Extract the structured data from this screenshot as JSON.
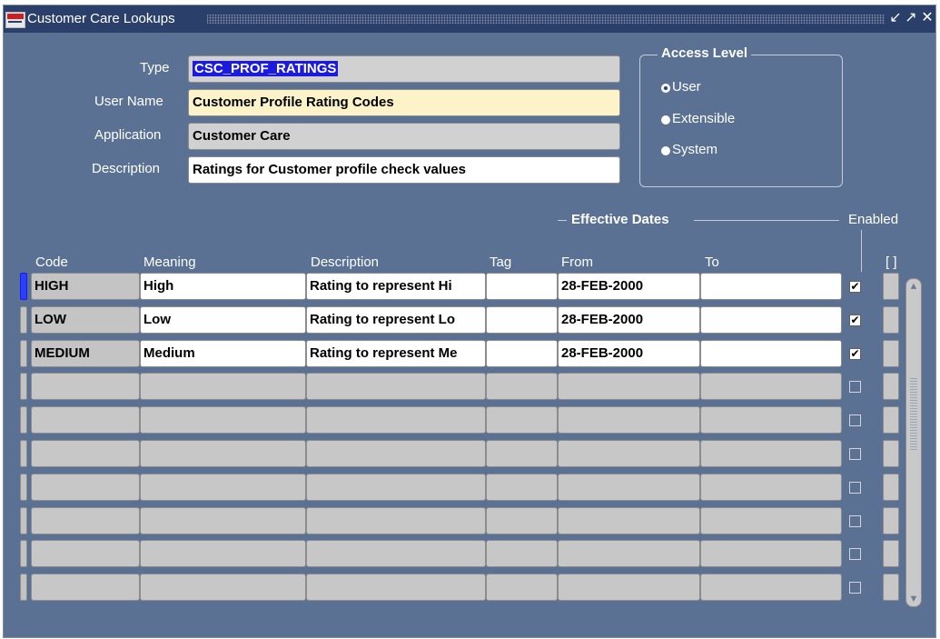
{
  "window": {
    "title": "Customer Care Lookups",
    "controls": [
      "minimize-icon",
      "maximize-icon",
      "close-icon"
    ]
  },
  "header_form": {
    "type_label": "Type",
    "type_value": "CSC_PROF_RATINGS",
    "user_name_label": "User Name",
    "user_name_value": "Customer Profile Rating Codes",
    "application_label": "Application",
    "application_value": "Customer Care",
    "description_label": "Description",
    "description_value": "Ratings for Customer profile check values"
  },
  "access_level": {
    "title": "Access Level",
    "selected": "User",
    "options": [
      "User",
      "Extensible",
      "System"
    ]
  },
  "grid": {
    "effective_dates_label": "Effective Dates",
    "enabled_label": "Enabled",
    "columns": {
      "code": "Code",
      "meaning": "Meaning",
      "description": "Description",
      "tag": "Tag",
      "from": "From",
      "to": "To",
      "flex": "[ ]"
    },
    "rows": [
      {
        "code": "HIGH",
        "meaning": "High",
        "description": "Rating to represent Hi",
        "tag": "",
        "from": "28-FEB-2000",
        "to": "",
        "enabled": true
      },
      {
        "code": "LOW",
        "meaning": "Low",
        "description": "Rating to represent Lo",
        "tag": "",
        "from": "28-FEB-2000",
        "to": "",
        "enabled": true
      },
      {
        "code": "MEDIUM",
        "meaning": "Medium",
        "description": "Rating to represent Me",
        "tag": "",
        "from": "28-FEB-2000",
        "to": "",
        "enabled": true
      },
      {
        "code": "",
        "meaning": "",
        "description": "",
        "tag": "",
        "from": "",
        "to": "",
        "enabled": false
      },
      {
        "code": "",
        "meaning": "",
        "description": "",
        "tag": "",
        "from": "",
        "to": "",
        "enabled": false
      },
      {
        "code": "",
        "meaning": "",
        "description": "",
        "tag": "",
        "from": "",
        "to": "",
        "enabled": false
      },
      {
        "code": "",
        "meaning": "",
        "description": "",
        "tag": "",
        "from": "",
        "to": "",
        "enabled": false
      },
      {
        "code": "",
        "meaning": "",
        "description": "",
        "tag": "",
        "from": "",
        "to": "",
        "enabled": false
      },
      {
        "code": "",
        "meaning": "",
        "description": "",
        "tag": "",
        "from": "",
        "to": "",
        "enabled": false
      },
      {
        "code": "",
        "meaning": "",
        "description": "",
        "tag": "",
        "from": "",
        "to": "",
        "enabled": false
      }
    ]
  },
  "colors": {
    "window_bg": "#5a7193",
    "titlebar_bg": "#2b3f6b",
    "selection": "#1a1ae0",
    "required_field": "#fcf4c8"
  }
}
